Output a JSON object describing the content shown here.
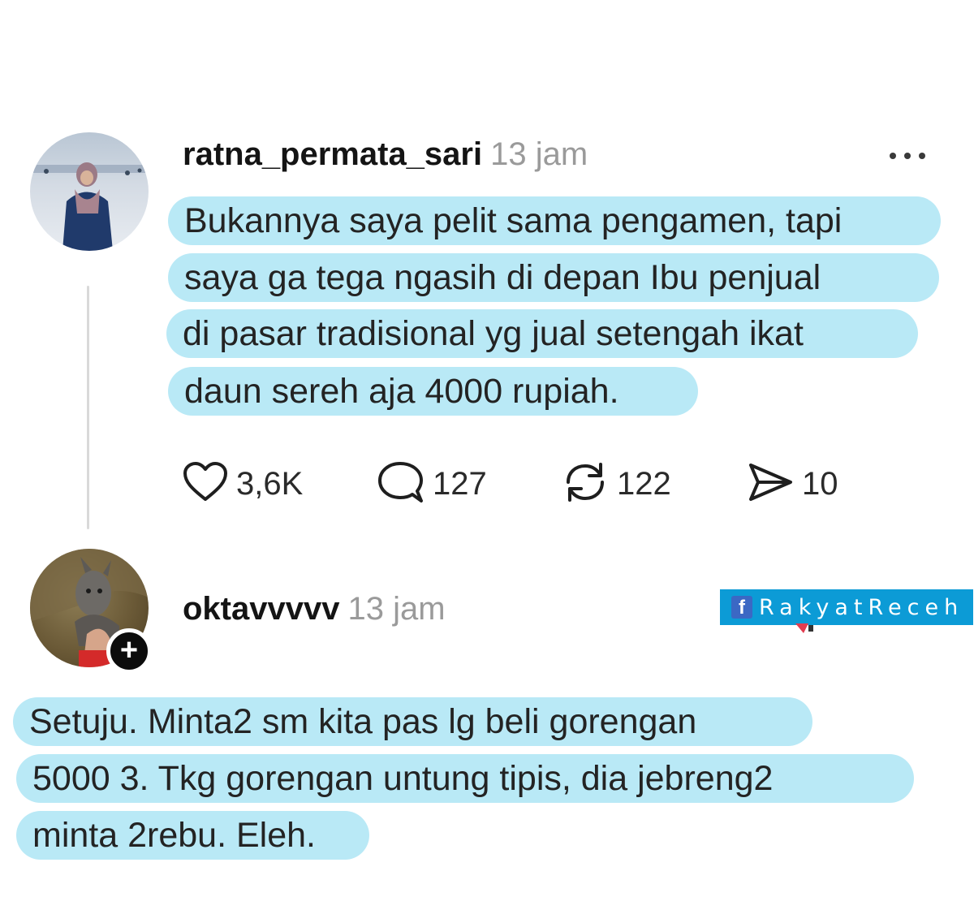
{
  "post": {
    "username": "ratna_permata_sari",
    "time": "13 jam",
    "more_icon": "more-horizontal-icon",
    "lines": [
      "Bukannya saya pelit sama pengamen, tapi",
      "saya ga tega ngasih di depan Ibu penjual",
      "di pasar tradisional yg jual setengah ikat",
      "daun sereh aja 4000 rupiah."
    ],
    "actions": {
      "likes": "3,6K",
      "comments": "127",
      "reposts": "122",
      "shares": "10"
    }
  },
  "reply": {
    "username": "oktavvvvv",
    "time": "13 jam",
    "follow_symbol": "+",
    "lines": [
      "Setuju. Minta2 sm kita pas lg beli gorengan",
      "5000 3. Tkg gorengan untung tipis, dia jebreng2",
      "minta 2rebu. Eleh."
    ]
  },
  "watermark": {
    "icon_letter": "f",
    "text": "RakyatReceh"
  },
  "colors": {
    "highlight": "#b9e9f6",
    "watermark_bg": "#0c9bd6",
    "timestamp": "#9a9a9a"
  }
}
